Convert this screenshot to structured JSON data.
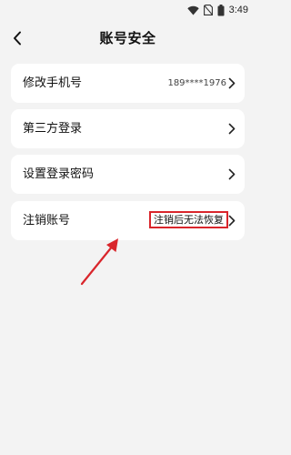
{
  "status_bar": {
    "time": "3:49",
    "icons": [
      "wifi-icon",
      "no-sim-icon",
      "battery-icon"
    ]
  },
  "header": {
    "title": "账号安全",
    "back_icon": "chevron-left-icon"
  },
  "settings": [
    {
      "label": "修改手机号",
      "value": "189****1976"
    },
    {
      "label": "第三方登录"
    },
    {
      "label": "设置登录密码"
    },
    {
      "label": "注销账号",
      "value": "注销后无法恢复"
    }
  ],
  "annotation": {
    "highlight_color": "#d9252b",
    "arrow_color": "#d9252b"
  }
}
